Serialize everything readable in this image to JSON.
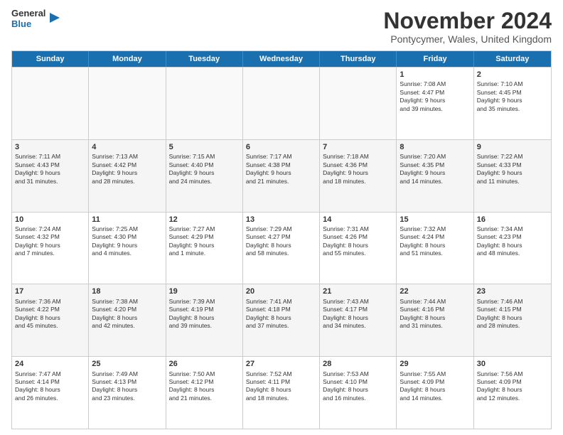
{
  "logo": {
    "line1": "General",
    "line2": "Blue"
  },
  "title": "November 2024",
  "subtitle": "Pontycymer, Wales, United Kingdom",
  "headers": [
    "Sunday",
    "Monday",
    "Tuesday",
    "Wednesday",
    "Thursday",
    "Friday",
    "Saturday"
  ],
  "weeks": [
    [
      {
        "day": "",
        "info": ""
      },
      {
        "day": "",
        "info": ""
      },
      {
        "day": "",
        "info": ""
      },
      {
        "day": "",
        "info": ""
      },
      {
        "day": "",
        "info": ""
      },
      {
        "day": "1",
        "info": "Sunrise: 7:08 AM\nSunset: 4:47 PM\nDaylight: 9 hours\nand 39 minutes."
      },
      {
        "day": "2",
        "info": "Sunrise: 7:10 AM\nSunset: 4:45 PM\nDaylight: 9 hours\nand 35 minutes."
      }
    ],
    [
      {
        "day": "3",
        "info": "Sunrise: 7:11 AM\nSunset: 4:43 PM\nDaylight: 9 hours\nand 31 minutes."
      },
      {
        "day": "4",
        "info": "Sunrise: 7:13 AM\nSunset: 4:42 PM\nDaylight: 9 hours\nand 28 minutes."
      },
      {
        "day": "5",
        "info": "Sunrise: 7:15 AM\nSunset: 4:40 PM\nDaylight: 9 hours\nand 24 minutes."
      },
      {
        "day": "6",
        "info": "Sunrise: 7:17 AM\nSunset: 4:38 PM\nDaylight: 9 hours\nand 21 minutes."
      },
      {
        "day": "7",
        "info": "Sunrise: 7:18 AM\nSunset: 4:36 PM\nDaylight: 9 hours\nand 18 minutes."
      },
      {
        "day": "8",
        "info": "Sunrise: 7:20 AM\nSunset: 4:35 PM\nDaylight: 9 hours\nand 14 minutes."
      },
      {
        "day": "9",
        "info": "Sunrise: 7:22 AM\nSunset: 4:33 PM\nDaylight: 9 hours\nand 11 minutes."
      }
    ],
    [
      {
        "day": "10",
        "info": "Sunrise: 7:24 AM\nSunset: 4:32 PM\nDaylight: 9 hours\nand 7 minutes."
      },
      {
        "day": "11",
        "info": "Sunrise: 7:25 AM\nSunset: 4:30 PM\nDaylight: 9 hours\nand 4 minutes."
      },
      {
        "day": "12",
        "info": "Sunrise: 7:27 AM\nSunset: 4:29 PM\nDaylight: 9 hours\nand 1 minute."
      },
      {
        "day": "13",
        "info": "Sunrise: 7:29 AM\nSunset: 4:27 PM\nDaylight: 8 hours\nand 58 minutes."
      },
      {
        "day": "14",
        "info": "Sunrise: 7:31 AM\nSunset: 4:26 PM\nDaylight: 8 hours\nand 55 minutes."
      },
      {
        "day": "15",
        "info": "Sunrise: 7:32 AM\nSunset: 4:24 PM\nDaylight: 8 hours\nand 51 minutes."
      },
      {
        "day": "16",
        "info": "Sunrise: 7:34 AM\nSunset: 4:23 PM\nDaylight: 8 hours\nand 48 minutes."
      }
    ],
    [
      {
        "day": "17",
        "info": "Sunrise: 7:36 AM\nSunset: 4:22 PM\nDaylight: 8 hours\nand 45 minutes."
      },
      {
        "day": "18",
        "info": "Sunrise: 7:38 AM\nSunset: 4:20 PM\nDaylight: 8 hours\nand 42 minutes."
      },
      {
        "day": "19",
        "info": "Sunrise: 7:39 AM\nSunset: 4:19 PM\nDaylight: 8 hours\nand 39 minutes."
      },
      {
        "day": "20",
        "info": "Sunrise: 7:41 AM\nSunset: 4:18 PM\nDaylight: 8 hours\nand 37 minutes."
      },
      {
        "day": "21",
        "info": "Sunrise: 7:43 AM\nSunset: 4:17 PM\nDaylight: 8 hours\nand 34 minutes."
      },
      {
        "day": "22",
        "info": "Sunrise: 7:44 AM\nSunset: 4:16 PM\nDaylight: 8 hours\nand 31 minutes."
      },
      {
        "day": "23",
        "info": "Sunrise: 7:46 AM\nSunset: 4:15 PM\nDaylight: 8 hours\nand 28 minutes."
      }
    ],
    [
      {
        "day": "24",
        "info": "Sunrise: 7:47 AM\nSunset: 4:14 PM\nDaylight: 8 hours\nand 26 minutes."
      },
      {
        "day": "25",
        "info": "Sunrise: 7:49 AM\nSunset: 4:13 PM\nDaylight: 8 hours\nand 23 minutes."
      },
      {
        "day": "26",
        "info": "Sunrise: 7:50 AM\nSunset: 4:12 PM\nDaylight: 8 hours\nand 21 minutes."
      },
      {
        "day": "27",
        "info": "Sunrise: 7:52 AM\nSunset: 4:11 PM\nDaylight: 8 hours\nand 18 minutes."
      },
      {
        "day": "28",
        "info": "Sunrise: 7:53 AM\nSunset: 4:10 PM\nDaylight: 8 hours\nand 16 minutes."
      },
      {
        "day": "29",
        "info": "Sunrise: 7:55 AM\nSunset: 4:09 PM\nDaylight: 8 hours\nand 14 minutes."
      },
      {
        "day": "30",
        "info": "Sunrise: 7:56 AM\nSunset: 4:09 PM\nDaylight: 8 hours\nand 12 minutes."
      }
    ]
  ]
}
